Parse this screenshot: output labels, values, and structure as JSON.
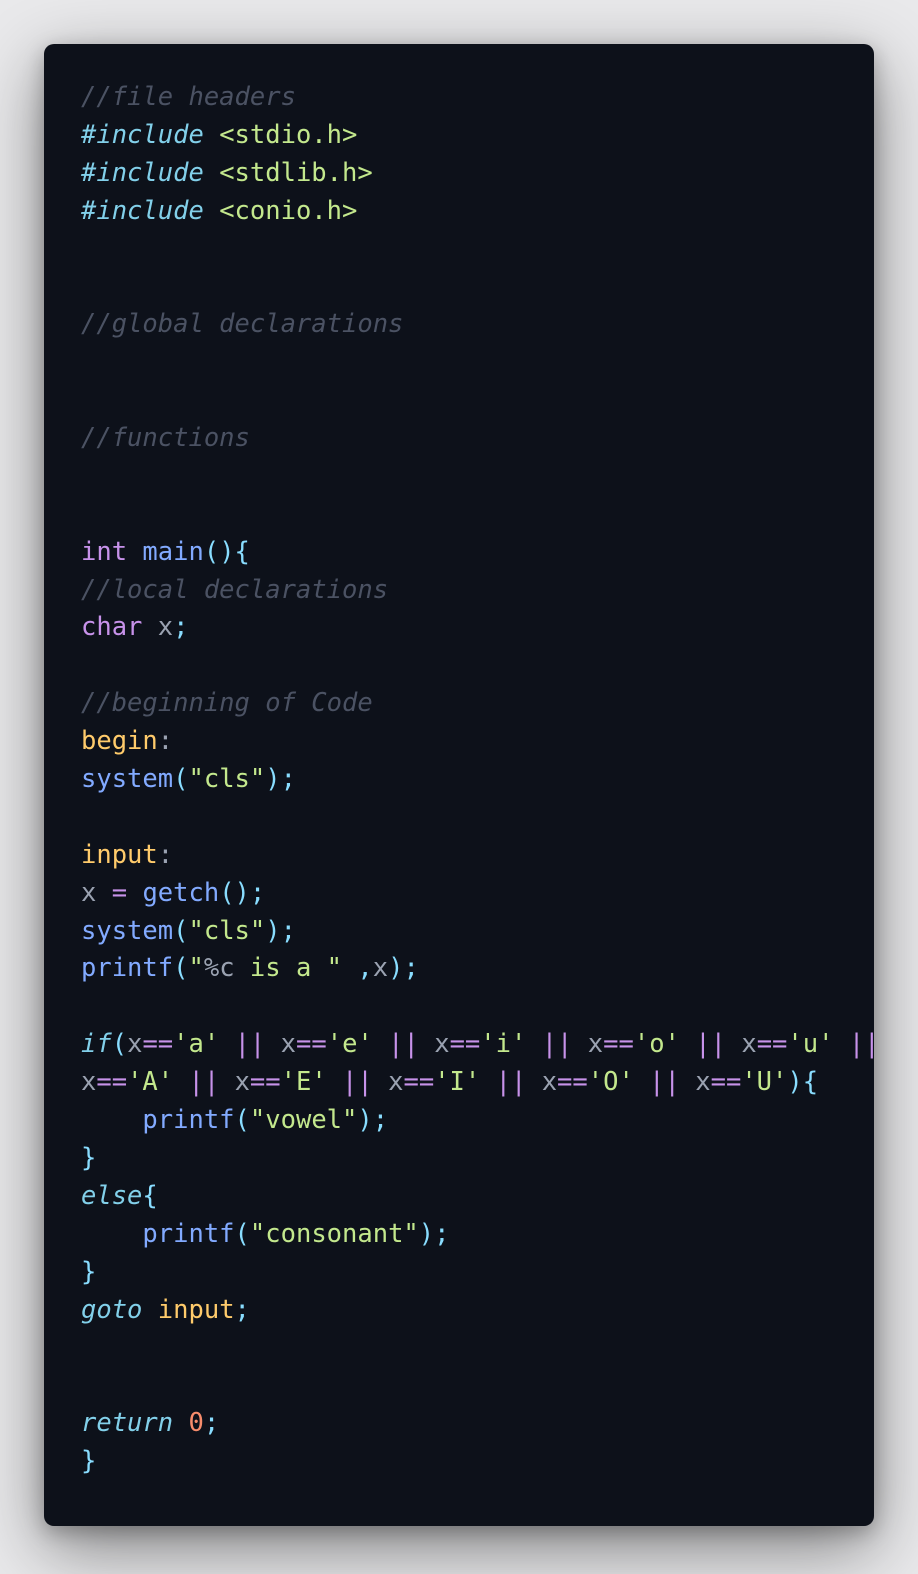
{
  "editor": {
    "lines": [
      [
        {
          "t": "//file headers",
          "k": "c"
        }
      ],
      [
        {
          "t": "#include",
          "k": "kw"
        },
        {
          "t": " ",
          "k": ""
        },
        {
          "t": "<stdio.h>",
          "k": "str"
        }
      ],
      [
        {
          "t": "#include",
          "k": "kw"
        },
        {
          "t": " ",
          "k": ""
        },
        {
          "t": "<stdlib.h>",
          "k": "str"
        }
      ],
      [
        {
          "t": "#include",
          "k": "kw"
        },
        {
          "t": " ",
          "k": ""
        },
        {
          "t": "<conio.h>",
          "k": "str"
        }
      ],
      [],
      [],
      [
        {
          "t": "//global declarations",
          "k": "c"
        }
      ],
      [],
      [],
      [
        {
          "t": "//functions",
          "k": "c"
        }
      ],
      [],
      [],
      [
        {
          "t": "int",
          "k": "ty"
        },
        {
          "t": " ",
          "k": ""
        },
        {
          "t": "main",
          "k": "fn"
        },
        {
          "t": "(){",
          "k": "p"
        }
      ],
      [
        {
          "t": "//local declarations",
          "k": "c"
        }
      ],
      [
        {
          "t": "char",
          "k": "ty"
        },
        {
          "t": " ",
          "k": ""
        },
        {
          "t": "x",
          "k": "var"
        },
        {
          "t": ";",
          "k": "p"
        }
      ],
      [],
      [
        {
          "t": "//beginning of Code",
          "k": "c"
        }
      ],
      [
        {
          "t": "begin",
          "k": "lbl"
        },
        {
          "t": ":",
          "k": "var"
        }
      ],
      [
        {
          "t": "system",
          "k": "fn"
        },
        {
          "t": "(",
          "k": "p"
        },
        {
          "t": "\"cls\"",
          "k": "str"
        },
        {
          "t": ");",
          "k": "p"
        }
      ],
      [],
      [
        {
          "t": "input",
          "k": "lbl"
        },
        {
          "t": ":",
          "k": "var"
        }
      ],
      [
        {
          "t": "x",
          "k": "var"
        },
        {
          "t": " ",
          "k": ""
        },
        {
          "t": "=",
          "k": "op"
        },
        {
          "t": " ",
          "k": ""
        },
        {
          "t": "getch",
          "k": "fn"
        },
        {
          "t": "();",
          "k": "p"
        }
      ],
      [
        {
          "t": "system",
          "k": "fn"
        },
        {
          "t": "(",
          "k": "p"
        },
        {
          "t": "\"cls\"",
          "k": "str"
        },
        {
          "t": ");",
          "k": "p"
        }
      ],
      [
        {
          "t": "printf",
          "k": "fn"
        },
        {
          "t": "(",
          "k": "p"
        },
        {
          "t": "\"",
          "k": "str"
        },
        {
          "t": "%c",
          "k": "fmt"
        },
        {
          "t": " is a \"",
          "k": "str"
        },
        {
          "t": " ,",
          "k": "p"
        },
        {
          "t": "x",
          "k": "var"
        },
        {
          "t": ");",
          "k": "p"
        }
      ],
      [],
      [
        {
          "t": "if",
          "k": "kw"
        },
        {
          "t": "(",
          "k": "p"
        },
        {
          "t": "x",
          "k": "var"
        },
        {
          "t": "==",
          "k": "op"
        },
        {
          "t": "'a'",
          "k": "str"
        },
        {
          "t": " || ",
          "k": "op"
        },
        {
          "t": "x",
          "k": "var"
        },
        {
          "t": "==",
          "k": "op"
        },
        {
          "t": "'e'",
          "k": "str"
        },
        {
          "t": " || ",
          "k": "op"
        },
        {
          "t": "x",
          "k": "var"
        },
        {
          "t": "==",
          "k": "op"
        },
        {
          "t": "'i'",
          "k": "str"
        },
        {
          "t": " || ",
          "k": "op"
        },
        {
          "t": "x",
          "k": "var"
        },
        {
          "t": "==",
          "k": "op"
        },
        {
          "t": "'o'",
          "k": "str"
        },
        {
          "t": " || ",
          "k": "op"
        },
        {
          "t": "x",
          "k": "var"
        },
        {
          "t": "==",
          "k": "op"
        },
        {
          "t": "'u'",
          "k": "str"
        },
        {
          "t": " ||",
          "k": "op"
        }
      ],
      [
        {
          "t": "x",
          "k": "var"
        },
        {
          "t": "==",
          "k": "op"
        },
        {
          "t": "'A'",
          "k": "str"
        },
        {
          "t": " || ",
          "k": "op"
        },
        {
          "t": "x",
          "k": "var"
        },
        {
          "t": "==",
          "k": "op"
        },
        {
          "t": "'E'",
          "k": "str"
        },
        {
          "t": " || ",
          "k": "op"
        },
        {
          "t": "x",
          "k": "var"
        },
        {
          "t": "==",
          "k": "op"
        },
        {
          "t": "'I'",
          "k": "str"
        },
        {
          "t": " || ",
          "k": "op"
        },
        {
          "t": "x",
          "k": "var"
        },
        {
          "t": "==",
          "k": "op"
        },
        {
          "t": "'O'",
          "k": "str"
        },
        {
          "t": " || ",
          "k": "op"
        },
        {
          "t": "x",
          "k": "var"
        },
        {
          "t": "==",
          "k": "op"
        },
        {
          "t": "'U'",
          "k": "str"
        },
        {
          "t": "){",
          "k": "p"
        }
      ],
      [
        {
          "t": "    ",
          "k": ""
        },
        {
          "t": "printf",
          "k": "fn"
        },
        {
          "t": "(",
          "k": "p"
        },
        {
          "t": "\"vowel\"",
          "k": "str"
        },
        {
          "t": ");",
          "k": "p"
        }
      ],
      [
        {
          "t": "}",
          "k": "p"
        }
      ],
      [
        {
          "t": "else",
          "k": "kw"
        },
        {
          "t": "{",
          "k": "p"
        }
      ],
      [
        {
          "t": "    ",
          "k": ""
        },
        {
          "t": "printf",
          "k": "fn"
        },
        {
          "t": "(",
          "k": "p"
        },
        {
          "t": "\"consonant\"",
          "k": "str"
        },
        {
          "t": ");",
          "k": "p"
        }
      ],
      [
        {
          "t": "}",
          "k": "p"
        }
      ],
      [
        {
          "t": "goto",
          "k": "kw"
        },
        {
          "t": " ",
          "k": ""
        },
        {
          "t": "input",
          "k": "lbl"
        },
        {
          "t": ";",
          "k": "p"
        }
      ],
      [],
      [],
      [
        {
          "t": "return",
          "k": "kw"
        },
        {
          "t": " ",
          "k": ""
        },
        {
          "t": "0",
          "k": "num"
        },
        {
          "t": ";",
          "k": "p"
        }
      ],
      [
        {
          "t": "}",
          "k": "p"
        }
      ]
    ]
  }
}
